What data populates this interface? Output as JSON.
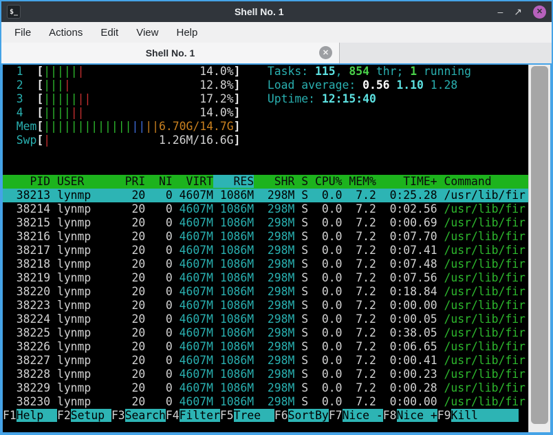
{
  "window": {
    "title": "Shell No. 1",
    "icon": "terminal-icon",
    "controls": {
      "minimize": "–",
      "maximize": "↗",
      "close": "✕"
    }
  },
  "menubar": {
    "items": [
      "File",
      "Actions",
      "Edit",
      "View",
      "Help"
    ]
  },
  "tab": {
    "label": "Shell No. 1",
    "close": "✕"
  },
  "palette": {
    "gray": "#d2d2d2",
    "cyan": "#29b0b0",
    "bright_cyan": "#5ce0e0",
    "green": "#2db82d",
    "bright_green": "#49d049",
    "red": "#c52f2f",
    "blue": "#3d6bd8",
    "orange": "#c9801f",
    "white": "#ffffff",
    "bracket": "#e6e6e6",
    "black": "#000000",
    "selection_bg": "#2db4b4",
    "header_bg": "#1db31d",
    "frame_blue": "#45a3e7"
  },
  "htop": {
    "meters": [
      {
        "label": "1",
        "segments": [
          [
            "green",
            5
          ],
          [
            "red",
            1
          ]
        ],
        "text": "14.0%",
        "text_color": "gray"
      },
      {
        "label": "2",
        "segments": [
          [
            "green",
            3
          ],
          [
            "red",
            1
          ]
        ],
        "text": "12.8%",
        "text_color": "gray"
      },
      {
        "label": "3",
        "segments": [
          [
            "green",
            5
          ],
          [
            "red",
            2
          ]
        ],
        "text": "17.2%",
        "text_color": "gray"
      },
      {
        "label": "4",
        "segments": [
          [
            "green",
            4
          ],
          [
            "red",
            2
          ]
        ],
        "text": "14.0%",
        "text_color": "gray"
      },
      {
        "label": "Mem",
        "segments": [
          [
            "green",
            13
          ],
          [
            "blue",
            2
          ],
          [
            "orange",
            2
          ]
        ],
        "text": "6.70G/14.7G",
        "text_color": "orange"
      },
      {
        "label": "Swp",
        "segments": [
          [
            "red",
            1
          ]
        ],
        "text": "1.26M/16.6G",
        "text_color": "gray"
      }
    ],
    "info_lines": [
      [
        {
          "t": "Tasks: ",
          "c": "cyan"
        },
        {
          "t": "115",
          "c": "bright_cyan",
          "b": 1
        },
        {
          "t": ", ",
          "c": "cyan"
        },
        {
          "t": "854",
          "c": "bright_green",
          "b": 1
        },
        {
          "t": " thr; ",
          "c": "cyan"
        },
        {
          "t": "1",
          "c": "bright_green",
          "b": 1
        },
        {
          "t": " running",
          "c": "cyan"
        }
      ],
      [
        {
          "t": "Load average: ",
          "c": "cyan"
        },
        {
          "t": "0.56 ",
          "c": "white",
          "b": 1
        },
        {
          "t": "1.10 ",
          "c": "bright_cyan",
          "b": 1
        },
        {
          "t": "1.28",
          "c": "cyan"
        }
      ],
      [
        {
          "t": "Uptime: ",
          "c": "cyan"
        },
        {
          "t": "12:15:40",
          "c": "bright_cyan",
          "b": 1
        }
      ]
    ],
    "columns": [
      "PID",
      "USER",
      "PRI",
      "NI",
      "VIRT",
      "RES",
      "SHR",
      "S",
      "CPU%",
      "MEM%",
      "TIME+",
      "Command"
    ],
    "sort_column": "RES",
    "processes": [
      {
        "pid": "38213",
        "user": "lynmp",
        "pri": "20",
        "ni": "0",
        "virt": "4607M",
        "res": "1086M",
        "shr": "298M",
        "s": "S",
        "cpu": "0.0",
        "mem": "7.2",
        "time": "0:25.28",
        "cmd": "/usr/lib/fir",
        "selected": true
      },
      {
        "pid": "38214",
        "user": "lynmp",
        "pri": "20",
        "ni": "0",
        "virt": "4607M",
        "res": "1086M",
        "shr": "298M",
        "s": "S",
        "cpu": "0.0",
        "mem": "7.2",
        "time": "0:02.56",
        "cmd": "/usr/lib/fir"
      },
      {
        "pid": "38215",
        "user": "lynmp",
        "pri": "20",
        "ni": "0",
        "virt": "4607M",
        "res": "1086M",
        "shr": "298M",
        "s": "S",
        "cpu": "0.0",
        "mem": "7.2",
        "time": "0:00.69",
        "cmd": "/usr/lib/fir"
      },
      {
        "pid": "38216",
        "user": "lynmp",
        "pri": "20",
        "ni": "0",
        "virt": "4607M",
        "res": "1086M",
        "shr": "298M",
        "s": "S",
        "cpu": "0.0",
        "mem": "7.2",
        "time": "0:07.70",
        "cmd": "/usr/lib/fir"
      },
      {
        "pid": "38217",
        "user": "lynmp",
        "pri": "20",
        "ni": "0",
        "virt": "4607M",
        "res": "1086M",
        "shr": "298M",
        "s": "S",
        "cpu": "0.0",
        "mem": "7.2",
        "time": "0:07.41",
        "cmd": "/usr/lib/fir"
      },
      {
        "pid": "38218",
        "user": "lynmp",
        "pri": "20",
        "ni": "0",
        "virt": "4607M",
        "res": "1086M",
        "shr": "298M",
        "s": "S",
        "cpu": "0.0",
        "mem": "7.2",
        "time": "0:07.48",
        "cmd": "/usr/lib/fir"
      },
      {
        "pid": "38219",
        "user": "lynmp",
        "pri": "20",
        "ni": "0",
        "virt": "4607M",
        "res": "1086M",
        "shr": "298M",
        "s": "S",
        "cpu": "0.0",
        "mem": "7.2",
        "time": "0:07.56",
        "cmd": "/usr/lib/fir"
      },
      {
        "pid": "38220",
        "user": "lynmp",
        "pri": "20",
        "ni": "0",
        "virt": "4607M",
        "res": "1086M",
        "shr": "298M",
        "s": "S",
        "cpu": "0.0",
        "mem": "7.2",
        "time": "0:18.84",
        "cmd": "/usr/lib/fir"
      },
      {
        "pid": "38223",
        "user": "lynmp",
        "pri": "20",
        "ni": "0",
        "virt": "4607M",
        "res": "1086M",
        "shr": "298M",
        "s": "S",
        "cpu": "0.0",
        "mem": "7.2",
        "time": "0:00.00",
        "cmd": "/usr/lib/fir"
      },
      {
        "pid": "38224",
        "user": "lynmp",
        "pri": "20",
        "ni": "0",
        "virt": "4607M",
        "res": "1086M",
        "shr": "298M",
        "s": "S",
        "cpu": "0.0",
        "mem": "7.2",
        "time": "0:00.05",
        "cmd": "/usr/lib/fir"
      },
      {
        "pid": "38225",
        "user": "lynmp",
        "pri": "20",
        "ni": "0",
        "virt": "4607M",
        "res": "1086M",
        "shr": "298M",
        "s": "S",
        "cpu": "0.0",
        "mem": "7.2",
        "time": "0:38.05",
        "cmd": "/usr/lib/fir"
      },
      {
        "pid": "38226",
        "user": "lynmp",
        "pri": "20",
        "ni": "0",
        "virt": "4607M",
        "res": "1086M",
        "shr": "298M",
        "s": "S",
        "cpu": "0.0",
        "mem": "7.2",
        "time": "0:06.65",
        "cmd": "/usr/lib/fir"
      },
      {
        "pid": "38227",
        "user": "lynmp",
        "pri": "20",
        "ni": "0",
        "virt": "4607M",
        "res": "1086M",
        "shr": "298M",
        "s": "S",
        "cpu": "0.0",
        "mem": "7.2",
        "time": "0:00.41",
        "cmd": "/usr/lib/fir"
      },
      {
        "pid": "38228",
        "user": "lynmp",
        "pri": "20",
        "ni": "0",
        "virt": "4607M",
        "res": "1086M",
        "shr": "298M",
        "s": "S",
        "cpu": "0.0",
        "mem": "7.2",
        "time": "0:00.23",
        "cmd": "/usr/lib/fir"
      },
      {
        "pid": "38229",
        "user": "lynmp",
        "pri": "20",
        "ni": "0",
        "virt": "4607M",
        "res": "1086M",
        "shr": "298M",
        "s": "S",
        "cpu": "0.0",
        "mem": "7.2",
        "time": "0:00.28",
        "cmd": "/usr/lib/fir"
      },
      {
        "pid": "38230",
        "user": "lynmp",
        "pri": "20",
        "ni": "0",
        "virt": "4607M",
        "res": "1086M",
        "shr": "298M",
        "s": "S",
        "cpu": "0.0",
        "mem": "7.2",
        "time": "0:00.00",
        "cmd": "/usr/lib/fir"
      }
    ],
    "fkeys": [
      {
        "key": "F1",
        "label": "Help"
      },
      {
        "key": "F2",
        "label": "Setup"
      },
      {
        "key": "F3",
        "label": "Search"
      },
      {
        "key": "F4",
        "label": "Filter"
      },
      {
        "key": "F5",
        "label": "Tree"
      },
      {
        "key": "F6",
        "label": "SortBy"
      },
      {
        "key": "F7",
        "label": "Nice -"
      },
      {
        "key": "F8",
        "label": "Nice +"
      },
      {
        "key": "F9",
        "label": "Kill"
      }
    ]
  }
}
